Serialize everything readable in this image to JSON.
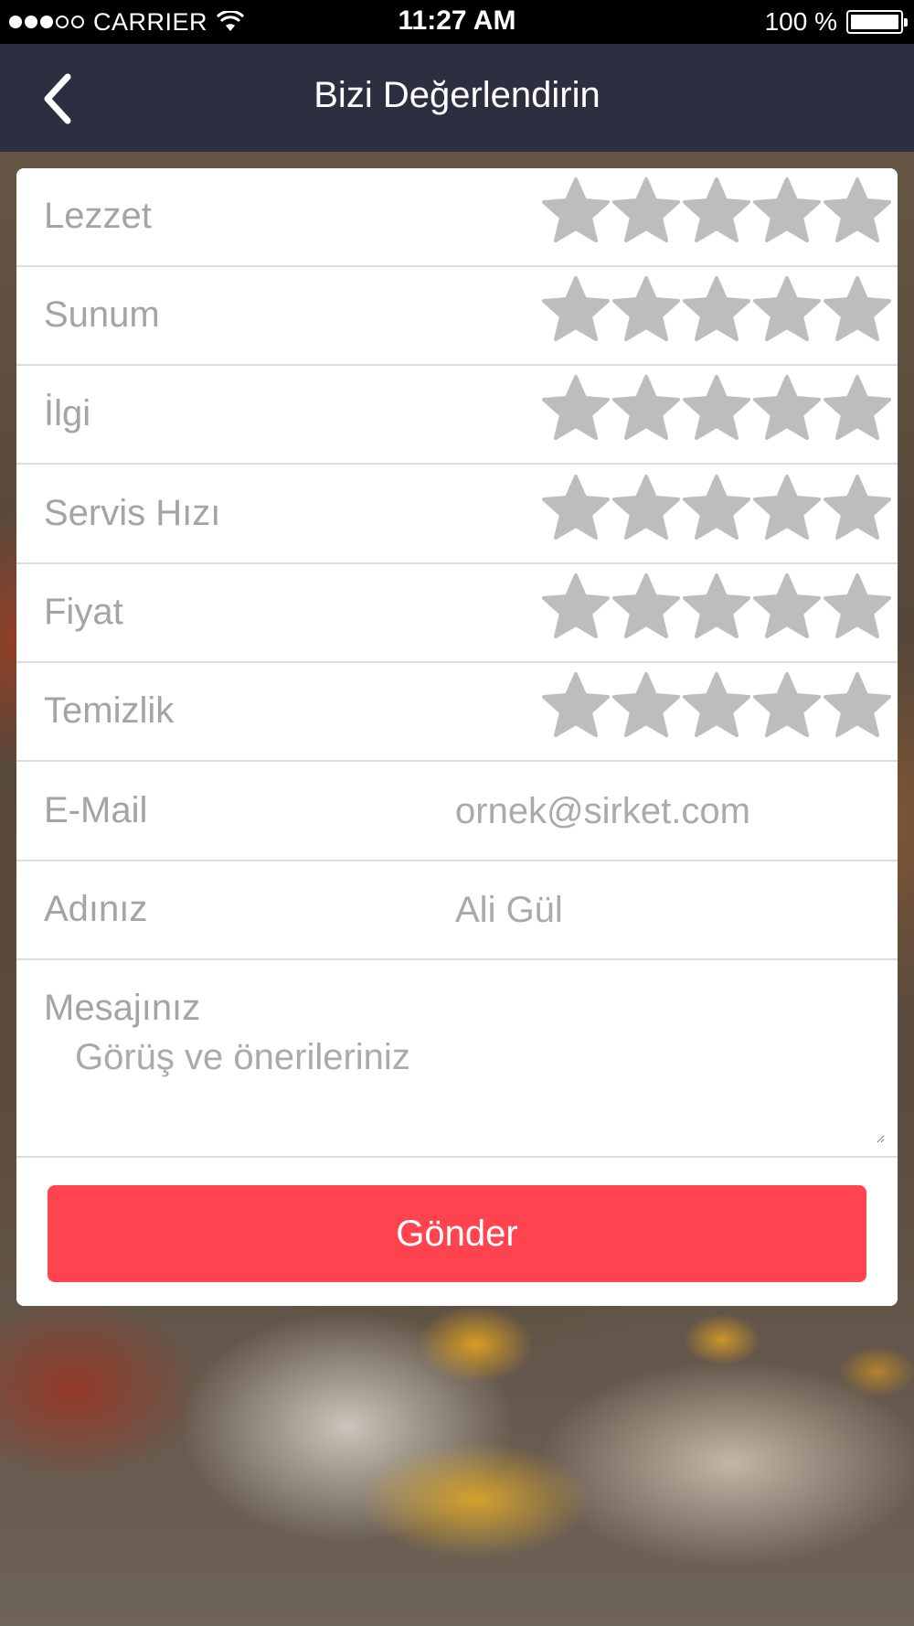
{
  "status_bar": {
    "carrier": "CARRIER",
    "time": "11:27 AM",
    "battery_text": "100 %",
    "signal_strength": 3,
    "signal_max": 5
  },
  "nav": {
    "title": "Bizi Değerlendirin",
    "back_icon": "chevron-left-icon"
  },
  "ratings": [
    {
      "label": "Lezzet",
      "value": 0,
      "max": 5
    },
    {
      "label": "Sunum",
      "value": 0,
      "max": 5
    },
    {
      "label": "İlgi",
      "value": 0,
      "max": 5
    },
    {
      "label": "Servis Hızı",
      "value": 0,
      "max": 5
    },
    {
      "label": "Fiyat",
      "value": 0,
      "max": 5
    },
    {
      "label": "Temizlik",
      "value": 0,
      "max": 5
    }
  ],
  "form": {
    "email_label": "E-Mail",
    "email_placeholder": "ornek@sirket.com",
    "email_value": "",
    "name_label": "Adınız",
    "name_placeholder": "Ali Gül",
    "name_value": "",
    "message_label": "Mesajınız",
    "message_placeholder": "Görüş ve önerileriniz",
    "message_value": ""
  },
  "submit_label": "Gönder",
  "colors": {
    "nav_bg": "#2b2f40",
    "accent": "#ff4450",
    "star_empty": "#bdbdbd",
    "label_text": "#a3a3a8"
  }
}
